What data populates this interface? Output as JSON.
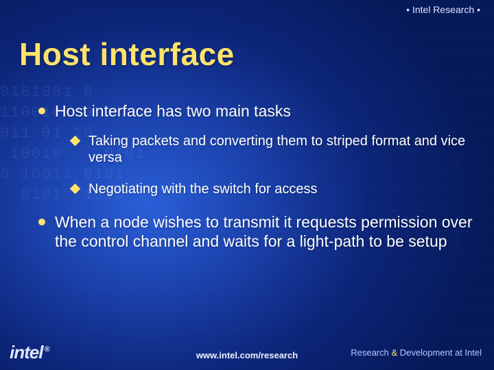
{
  "header": {
    "label": "• Intel Research •"
  },
  "title": "Host interface",
  "bullets": [
    {
      "text": "Host interface has two main tasks",
      "sub": [
        {
          "text": "Taking packets and converting them to striped format and vice versa"
        },
        {
          "text": "Negotiating with the switch for access"
        }
      ]
    },
    {
      "text": "When a node wishes to transmit it requests permission over the control channel and waits for a light-path to be setup",
      "sub": []
    }
  ],
  "footer": {
    "url": "www.intel.com/research",
    "logo": "intel",
    "logo_mark": "®",
    "tagline_left": "Research ",
    "tagline_amp": "&",
    "tagline_right": " Development at Intel"
  },
  "decor": {
    "digits": "0101001 0\n1100101 0 1\n011 01 10\n 10010    0101\n0 10011 0101\n  0101  1010"
  }
}
